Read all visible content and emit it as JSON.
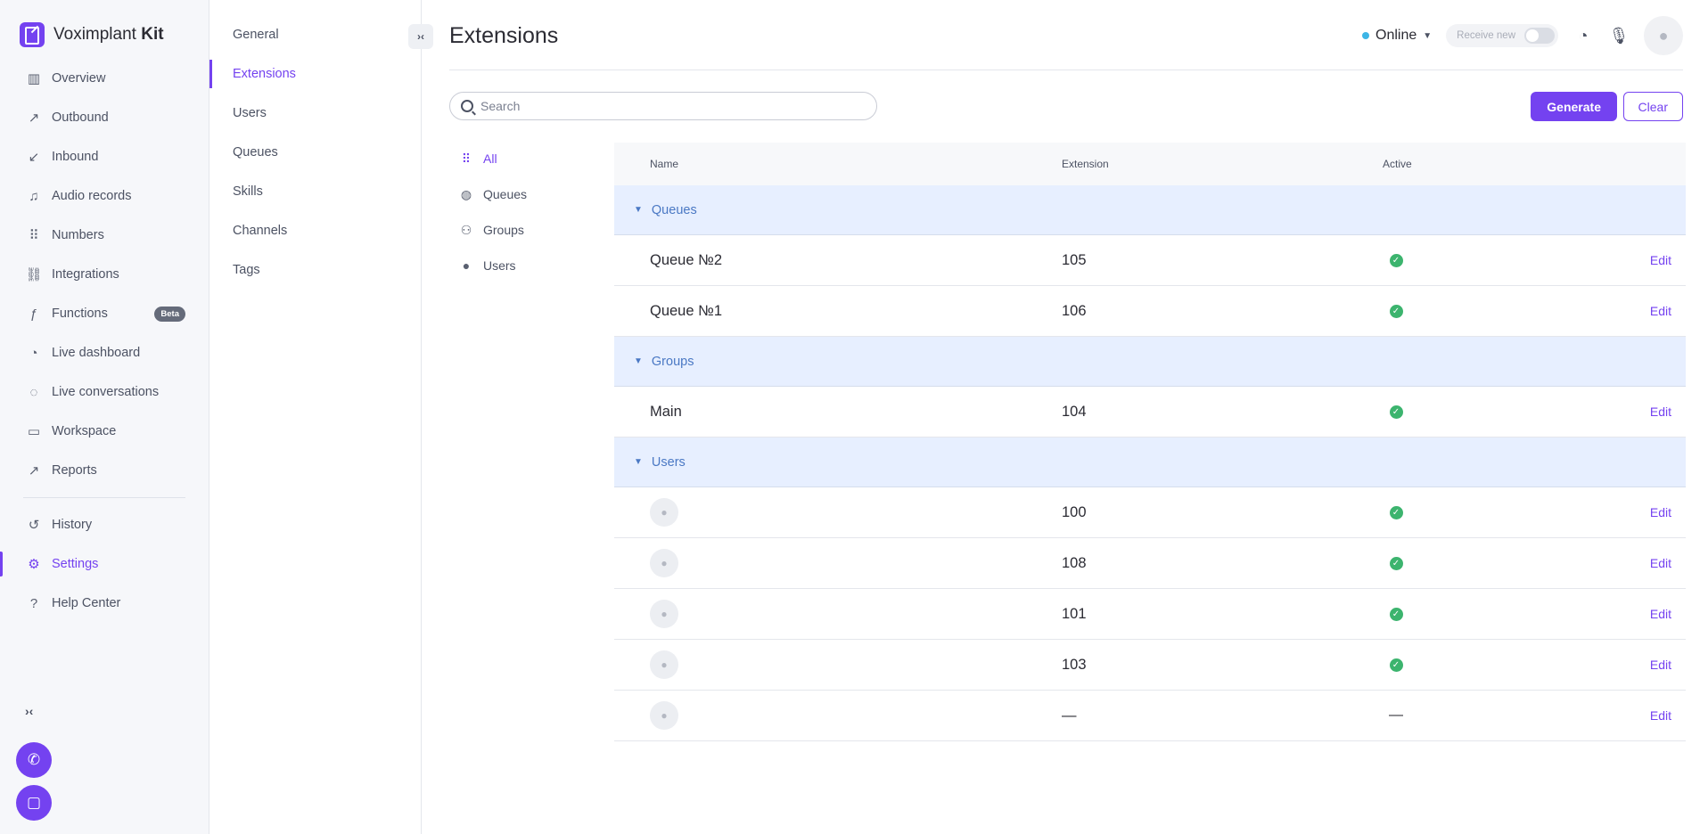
{
  "brand": {
    "name": "Voximplant",
    "suffix": "Kit"
  },
  "nav": {
    "items": [
      {
        "label": "Overview",
        "icon": "▥"
      },
      {
        "label": "Outbound",
        "icon": "↗"
      },
      {
        "label": "Inbound",
        "icon": "↙"
      },
      {
        "label": "Audio records",
        "icon": "♫"
      },
      {
        "label": "Numbers",
        "icon": "⠿"
      },
      {
        "label": "Integrations",
        "icon": "⛓"
      },
      {
        "label": "Functions",
        "icon": "ƒ",
        "badge": "Beta"
      },
      {
        "label": "Live dashboard",
        "icon": "◔"
      },
      {
        "label": "Live conversations",
        "icon": "◌"
      },
      {
        "label": "Workspace",
        "icon": "▭"
      },
      {
        "label": "Reports",
        "icon": "↗"
      }
    ],
    "bottom_items": [
      {
        "label": "History",
        "icon": "↺"
      },
      {
        "label": "Settings",
        "icon": "⚙"
      },
      {
        "label": "Help Center",
        "icon": "?"
      }
    ],
    "collapse_icon": "›‹"
  },
  "submenu": {
    "items": [
      "General",
      "Extensions",
      "Users",
      "Queues",
      "Skills",
      "Channels",
      "Tags"
    ],
    "collapse_icon": "›‹"
  },
  "header": {
    "title": "Extensions",
    "status": "Online",
    "receive_new": "Receive new"
  },
  "search": {
    "placeholder": "Search"
  },
  "actions": {
    "generate": "Generate",
    "clear": "Clear"
  },
  "filters": [
    {
      "label": "All",
      "icon": "⠿"
    },
    {
      "label": "Queues",
      "icon": "◍"
    },
    {
      "label": "Groups",
      "icon": "⚇"
    },
    {
      "label": "Users",
      "icon": "●"
    }
  ],
  "table": {
    "columns": {
      "name": "Name",
      "extension": "Extension",
      "active": "Active"
    },
    "edit_label": "Edit",
    "groups": [
      {
        "label": "Queues",
        "rows": [
          {
            "name": "Queue №2",
            "extension": "105",
            "active": true
          },
          {
            "name": "Queue №1",
            "extension": "106",
            "active": true
          }
        ]
      },
      {
        "label": "Groups",
        "rows": [
          {
            "name": "Main",
            "extension": "104",
            "active": true
          }
        ]
      },
      {
        "label": "Users",
        "rows": [
          {
            "name": "",
            "extension": "100",
            "active": true
          },
          {
            "name": "",
            "extension": "108",
            "active": true
          },
          {
            "name": "",
            "extension": "101",
            "active": true
          },
          {
            "name": "",
            "extension": "103",
            "active": true
          },
          {
            "name": "",
            "extension": "—",
            "active": "—"
          }
        ]
      }
    ]
  },
  "colors": {
    "accent": "#7442f0",
    "group_bg": "#e7efff",
    "group_text": "#4a78c4",
    "active_check": "#3cb46e",
    "status_online": "#3db5e6"
  }
}
